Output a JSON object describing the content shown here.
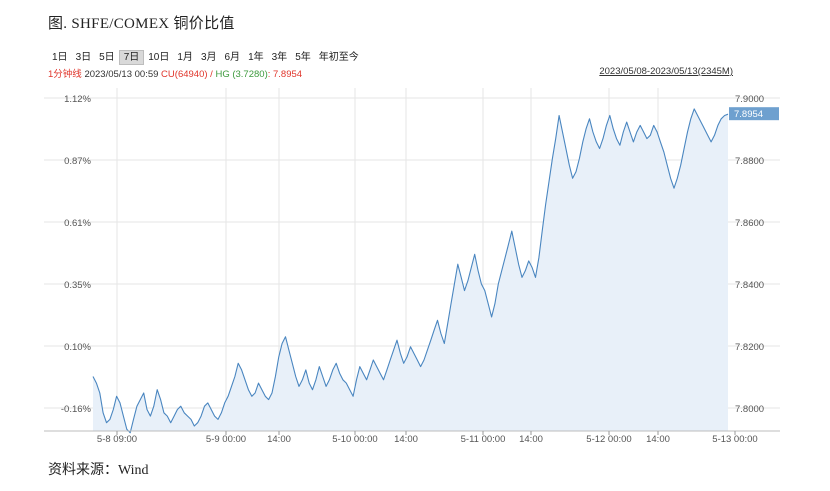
{
  "title": "图. SHFE/COMEX 铜价比值",
  "toolbar": {
    "buttons": [
      "1日",
      "3日",
      "5日",
      "7日",
      "10日",
      "1月",
      "3月",
      "6月",
      "1年",
      "3年",
      "5年",
      "年初至今"
    ],
    "active": "7日"
  },
  "info": {
    "interval": "1分钟线",
    "datetime": "2023/05/13 00:59",
    "cu_label": "CU",
    "cu_value": "(64940)",
    "separator": "/",
    "hg_label": "HG",
    "hg_value": "(3.7280)",
    "ratio_text": ": 7.8954",
    "range": "2023/05/08-2023/05/13(2345M)"
  },
  "source": "资料来源：Wind",
  "colors": {
    "line": "#4a86c0",
    "fill": "#e8f0f9",
    "badge": "#6ea0cf",
    "grid": "#e6e6e6",
    "red": "#e0352b",
    "green": "#3d9a3d"
  },
  "chart_data": {
    "type": "line",
    "left_axis_ticks": [
      "1.12%",
      "0.87%",
      "0.61%",
      "0.35%",
      "0.10%",
      "-0.16%"
    ],
    "right_axis_ticks": [
      "7.9000",
      "7.8800",
      "7.8600",
      "7.8400",
      "7.8200",
      "7.8000"
    ],
    "ylim": [
      7.7995,
      7.9003
    ],
    "x_tick_labels": [
      "5-8 09:00",
      "5-9 00:00",
      "14:00",
      "5-10 00:00",
      "14:00",
      "5-11 00:00",
      "14:00",
      "5-12 00:00",
      "14:00",
      "5-13 00:00"
    ],
    "last_value_label": "7.8954",
    "series": [
      {
        "values": [
          7.816,
          7.814,
          7.811,
          7.805,
          7.802,
          7.803,
          7.806,
          7.81,
          7.808,
          7.804,
          7.8,
          7.799,
          7.803,
          7.807,
          7.809,
          7.811,
          7.806,
          7.804,
          7.807,
          7.812,
          7.809,
          7.805,
          7.804,
          7.802,
          7.804,
          7.806,
          7.807,
          7.805,
          7.804,
          7.803,
          7.801,
          7.802,
          7.804,
          7.807,
          7.808,
          7.806,
          7.804,
          7.803,
          7.805,
          7.808,
          7.81,
          7.813,
          7.816,
          7.82,
          7.818,
          7.815,
          7.812,
          7.81,
          7.811,
          7.814,
          7.812,
          7.81,
          7.809,
          7.811,
          7.816,
          7.822,
          7.826,
          7.828,
          7.824,
          7.82,
          7.816,
          7.813,
          7.815,
          7.818,
          7.814,
          7.812,
          7.815,
          7.819,
          7.816,
          7.813,
          7.815,
          7.818,
          7.82,
          7.817,
          7.815,
          7.814,
          7.812,
          7.81,
          7.815,
          7.819,
          7.817,
          7.815,
          7.818,
          7.821,
          7.819,
          7.817,
          7.815,
          7.818,
          7.821,
          7.824,
          7.827,
          7.823,
          7.82,
          7.822,
          7.825,
          7.823,
          7.821,
          7.819,
          7.821,
          7.824,
          7.827,
          7.83,
          7.833,
          7.829,
          7.826,
          7.832,
          7.838,
          7.844,
          7.85,
          7.846,
          7.842,
          7.845,
          7.849,
          7.853,
          7.848,
          7.844,
          7.842,
          7.838,
          7.834,
          7.838,
          7.844,
          7.848,
          7.852,
          7.856,
          7.86,
          7.855,
          7.85,
          7.846,
          7.848,
          7.851,
          7.849,
          7.846,
          7.852,
          7.86,
          7.868,
          7.875,
          7.882,
          7.888,
          7.895,
          7.89,
          7.885,
          7.88,
          7.876,
          7.878,
          7.882,
          7.887,
          7.891,
          7.894,
          7.89,
          7.887,
          7.885,
          7.888,
          7.892,
          7.895,
          7.891,
          7.888,
          7.886,
          7.89,
          7.893,
          7.89,
          7.887,
          7.89,
          7.892,
          7.89,
          7.888,
          7.889,
          7.892,
          7.89,
          7.887,
          7.884,
          7.88,
          7.876,
          7.873,
          7.876,
          7.88,
          7.885,
          7.89,
          7.894,
          7.897,
          7.895,
          7.893,
          7.891,
          7.889,
          7.887,
          7.889,
          7.892,
          7.894,
          7.895,
          7.8954
        ]
      }
    ]
  }
}
